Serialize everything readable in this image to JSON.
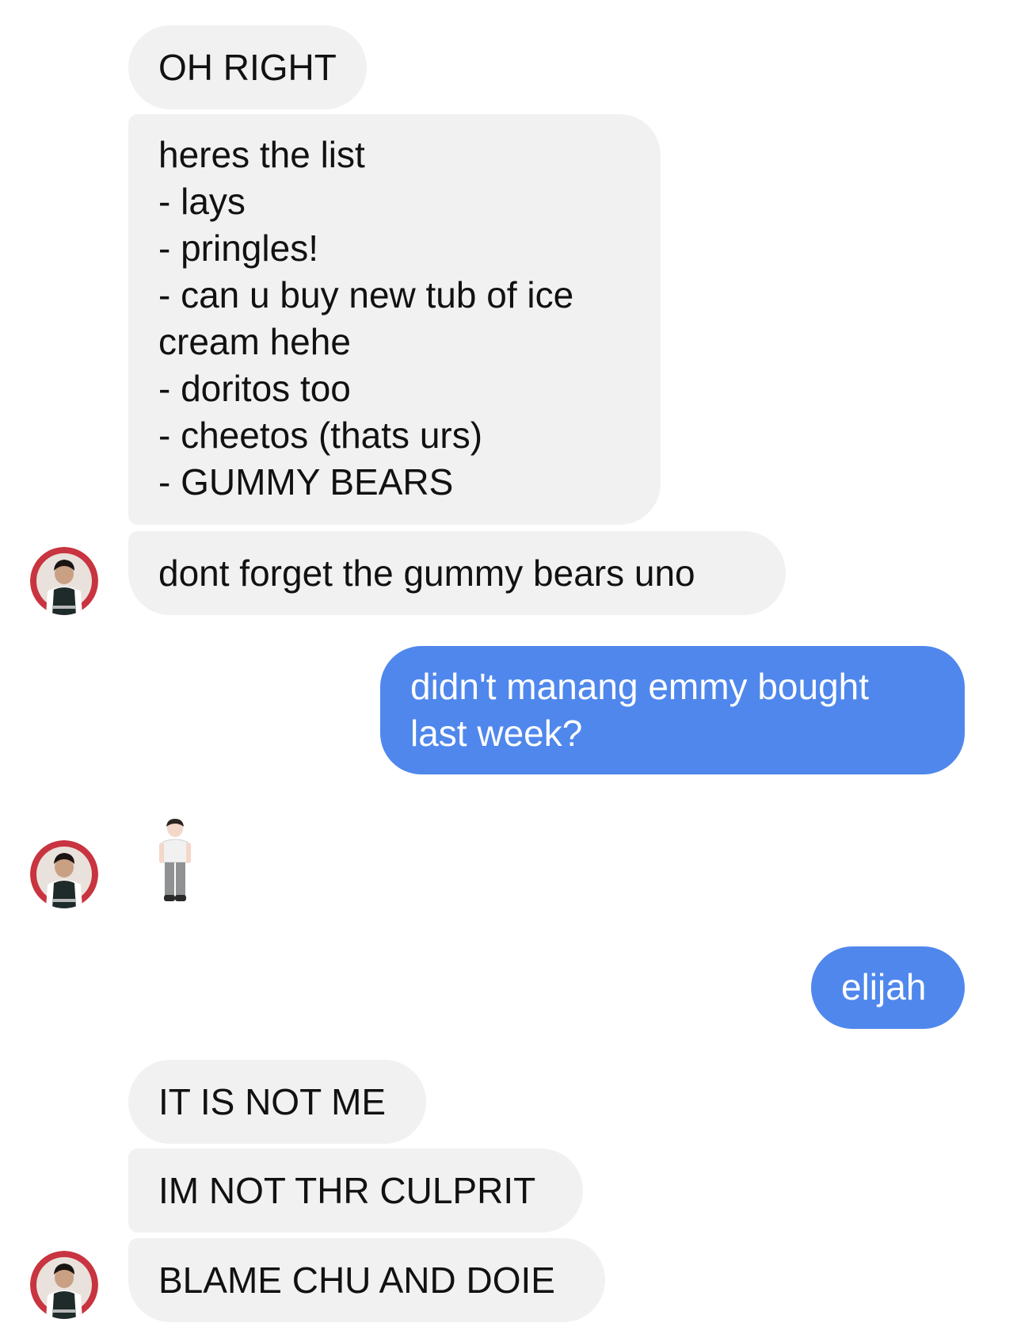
{
  "conversation": {
    "messages": [
      {
        "sender": "them",
        "text": "OH RIGHT"
      },
      {
        "sender": "them",
        "text": "heres the list\n- lays\n- pringles!\n- can u buy new tub of ice\ncream hehe\n- doritos too\n- cheetos (thats urs)\n- GUMMY BEARS"
      },
      {
        "sender": "them",
        "text": "dont forget the gummy bears uno"
      },
      {
        "sender": "me",
        "text": "didn't manang emmy bought\nlast week?"
      },
      {
        "sender": "them",
        "emoji": "standing-person-emoji"
      },
      {
        "sender": "me",
        "text": "elijah"
      },
      {
        "sender": "them",
        "text": "IT IS NOT ME"
      },
      {
        "sender": "them",
        "text": "IM NOT THR CULPRIT"
      },
      {
        "sender": "them",
        "text": "BLAME CHU AND DOIE"
      }
    ]
  },
  "colors": {
    "incoming_bubble": "#f1f1f1",
    "outgoing_bubble": "#4f87ec",
    "avatar_ring": "#c8343f"
  }
}
